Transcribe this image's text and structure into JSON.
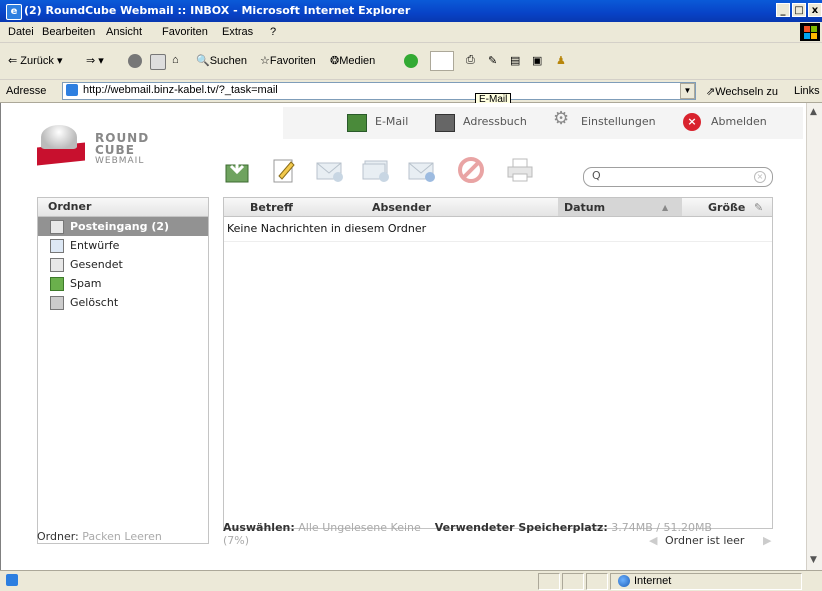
{
  "window": {
    "title": "(2) RoundCube Webmail :: INBOX - Microsoft Internet Explorer"
  },
  "menu": [
    "Datei",
    "Bearbeiten",
    "Ansicht",
    "Favoriten",
    "Extras",
    "?"
  ],
  "toolbar": {
    "back": "Zurück",
    "search": "Suchen",
    "favorites": "Favoriten",
    "media": "Medien"
  },
  "address": {
    "label": "Adresse",
    "url": "http://webmail.binz-kabel.tv/?_task=mail",
    "go": "Wechseln zu",
    "links": "Links"
  },
  "tooltip": "E-Mail",
  "logo": {
    "line1": "ROUND",
    "line2": "CUBE",
    "line3": "WEBMAIL"
  },
  "nav": {
    "mail": "E-Mail",
    "addressbook": "Adressbuch",
    "settings": "Einstellungen",
    "logout": "Abmelden"
  },
  "folders": {
    "header": "Ordner",
    "items": [
      {
        "label": "Posteingang (2)",
        "selected": true,
        "icon": "inbox-icon"
      },
      {
        "label": "Entwürfe",
        "selected": false,
        "icon": "drafts-icon"
      },
      {
        "label": "Gesendet",
        "selected": false,
        "icon": "sent-icon"
      },
      {
        "label": "Spam",
        "selected": false,
        "icon": "spam-icon"
      },
      {
        "label": "Gelöscht",
        "selected": false,
        "icon": "trash-icon"
      }
    ],
    "footer_label": "Ordner:",
    "compact": "Packen",
    "empty": "Leeren"
  },
  "messagelist": {
    "columns": {
      "subject": "Betreff",
      "sender": "Absender",
      "date": "Datum",
      "size": "Größe"
    },
    "empty": "Keine Nachrichten in diesem Ordner"
  },
  "footer": {
    "select_label": "Auswählen:",
    "all": "Alle",
    "unread": "Ungelesene",
    "none": "Keine",
    "quota_label": "Verwendeter Speicherplatz:",
    "quota": "3.74MB / 51.20MB",
    "quota_pct": "(7%)",
    "folder_status": "Ordner ist leer"
  },
  "status": {
    "zone": "Internet"
  }
}
